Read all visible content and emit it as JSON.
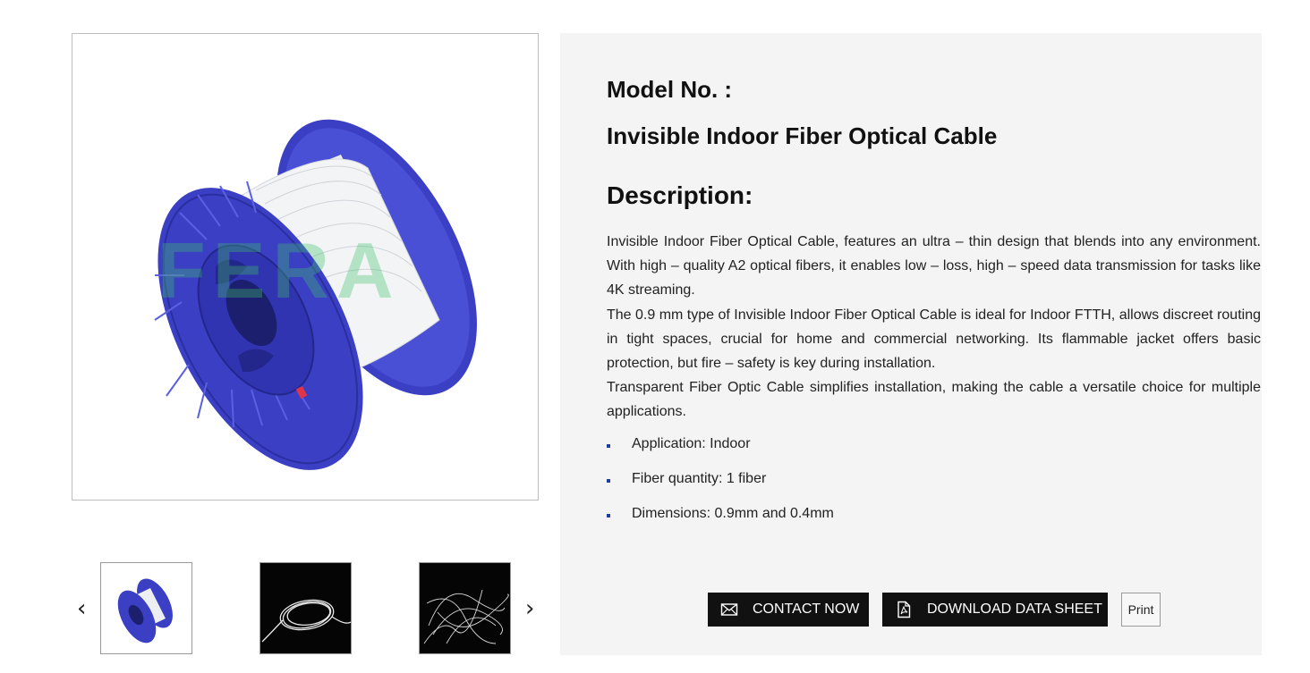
{
  "gallery": {
    "watermark": "FERA",
    "prev_arrow": "‹",
    "next_arrow": "›",
    "thumbnails": [
      "spool-thumbnail",
      "coil-thumbnail",
      "loose-fiber-thumbnail"
    ]
  },
  "product": {
    "model_label": "Model No. :",
    "name": "Invisible Indoor Fiber Optical Cable",
    "description_heading": "Description:",
    "description_paragraphs": [
      "Invisible Indoor Fiber Optical Cable, features an ultra – thin design that blends into any environment. With high – quality A2 optical fibers, it enables low – loss, high – speed data transmission for tasks like 4K streaming.",
      "The 0.9 mm type of Invisible Indoor Fiber Optical Cable is ideal for Indoor FTTH, allows discreet routing in tight spaces, crucial for home and commercial networking. Its flammable jacket offers basic protection, but fire – safety is key during installation.",
      "Transparent Fiber Optic Cable simplifies installation, making the cable a versatile choice for multiple applications."
    ],
    "specs": [
      "Application: Indoor",
      "Fiber quantity: 1 fiber",
      "Dimensions: 0.9mm and 0.4mm"
    ]
  },
  "actions": {
    "contact_label": "CONTACT NOW",
    "download_label": "DOWNLOAD DATA SHEET",
    "print_label": "Print"
  },
  "colors": {
    "spool_blue": "#3a3fc4",
    "panel_bg": "#f4f4f4",
    "button_bg": "#111111",
    "bullet": "#1f3d9a"
  },
  "icons": {
    "contact": "envelope-icon",
    "download": "pdf-file-icon"
  }
}
